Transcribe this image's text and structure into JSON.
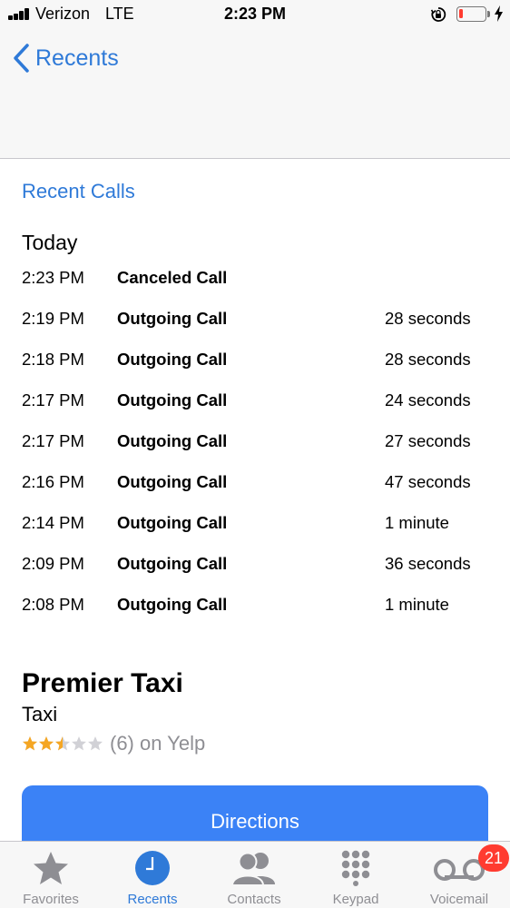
{
  "status_bar": {
    "carrier": "Verizon",
    "network": "LTE",
    "time": "2:23 PM",
    "battery_level": 0.15,
    "battery_color": "#ff3b30"
  },
  "nav": {
    "back_label": "Recents"
  },
  "section": {
    "recent_calls_label": "Recent Calls",
    "date_heading": "Today"
  },
  "calls": [
    {
      "time": "2:23 PM",
      "type": "Canceled Call",
      "duration": ""
    },
    {
      "time": "2:19 PM",
      "type": "Outgoing Call",
      "duration": "28 seconds"
    },
    {
      "time": "2:18 PM",
      "type": "Outgoing Call",
      "duration": "28 seconds"
    },
    {
      "time": "2:17 PM",
      "type": "Outgoing Call",
      "duration": "24 seconds"
    },
    {
      "time": "2:17 PM",
      "type": "Outgoing Call",
      "duration": "27 seconds"
    },
    {
      "time": "2:16 PM",
      "type": "Outgoing Call",
      "duration": "47 seconds"
    },
    {
      "time": "2:14 PM",
      "type": "Outgoing Call",
      "duration": "1 minute"
    },
    {
      "time": "2:09 PM",
      "type": "Outgoing Call",
      "duration": "36 seconds"
    },
    {
      "time": "2:08 PM",
      "type": "Outgoing Call",
      "duration": "1 minute"
    }
  ],
  "business": {
    "name": "Premier Taxi",
    "category": "Taxi",
    "rating": 2.5,
    "rating_max": 5,
    "review_text": "(6) on Yelp",
    "directions_label": "Directions"
  },
  "tab_bar": {
    "tabs": [
      {
        "label": "Favorites",
        "icon": "star-icon"
      },
      {
        "label": "Recents",
        "icon": "clock-icon",
        "active": true
      },
      {
        "label": "Contacts",
        "icon": "contacts-icon"
      },
      {
        "label": "Keypad",
        "icon": "keypad-icon"
      },
      {
        "label": "Voicemail",
        "icon": "voicemail-icon"
      }
    ],
    "voicemail_badge": "21"
  },
  "colors": {
    "accent": "#2f7ad8",
    "button": "#3b82f6",
    "star": "#f5a623",
    "badge": "#ff3b30"
  }
}
